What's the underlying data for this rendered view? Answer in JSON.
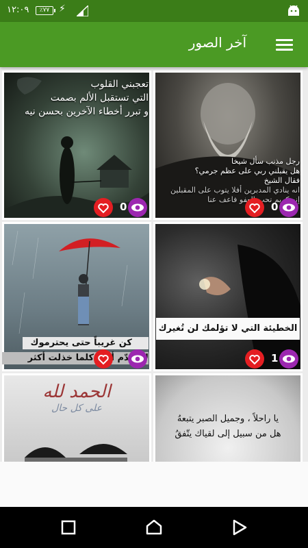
{
  "status": {
    "time": "١٢:٠٩",
    "battery": "٪٧٧"
  },
  "appbar": {
    "title": "آخر الصور"
  },
  "posts": [
    {
      "caption": [
        "تعجبني القلوب",
        "التي تستقبل الألم بصمت",
        "و تبرر أخطاء الآخرين بحسن نيه"
      ],
      "views": "0"
    },
    {
      "caption": [
        "رجل مذنب سأل شيخا",
        "هل يقبلني ربي على عظم جرمي؟",
        "فقال الشيخ",
        "انه ينادي المدبرين أفلا يتوب على المقبلين",
        "إنه كريم تحب العفو فاعف عنا"
      ],
      "views": "0"
    },
    {
      "caption": [
        "كن غريباً حتى يحترموك",
        "لا تُقدّم أكثر كلما خذلت أكثر"
      ],
      "views": ""
    },
    {
      "caption": [
        "الخطيئة التي لا تؤلمك لن تُغيرك"
      ],
      "views": "1"
    },
    {
      "caption": [
        "الحمد لله",
        "على كل حال"
      ],
      "views": ""
    },
    {
      "caption": [
        "يا راحلاً ، وجميل الصبر يتبعهُ",
        "هل من سبيل إلى لقياك يتّفقُ"
      ],
      "views": ""
    }
  ]
}
